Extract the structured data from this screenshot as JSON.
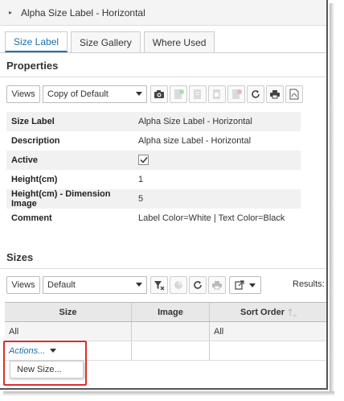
{
  "window": {
    "title": "Alpha Size Label - Horizontal"
  },
  "tabs": [
    {
      "label": "Size Label",
      "active": true
    },
    {
      "label": "Size Gallery",
      "active": false
    },
    {
      "label": "Where Used",
      "active": false
    }
  ],
  "properties": {
    "heading": "Properties",
    "views_label": "Views",
    "view_selected": "Copy of Default",
    "rows": [
      {
        "label": "Size Label",
        "value": "Alpha Size Label - Horizontal"
      },
      {
        "label": "Description",
        "value": "Alpha size Label - Horizontal"
      },
      {
        "label": "Active",
        "value": ""
      },
      {
        "label": "Height(cm)",
        "value": "1"
      },
      {
        "label": "Height(cm) - Dimension Image",
        "value": "5"
      },
      {
        "label": "Comment",
        "value": "Label Color=White | Text Color=Black"
      }
    ],
    "active_checked": true
  },
  "sizes": {
    "heading": "Sizes",
    "views_label": "Views",
    "view_selected": "Default",
    "results_label": "Results:",
    "columns": [
      "Size",
      "Image",
      "Sort Order"
    ],
    "filter_row": [
      "All",
      "",
      "All"
    ],
    "actions_label": "Actions...",
    "menu_items": [
      "New Size..."
    ]
  },
  "colors": {
    "accent": "#1a6fb5",
    "highlight": "#d9302b"
  }
}
